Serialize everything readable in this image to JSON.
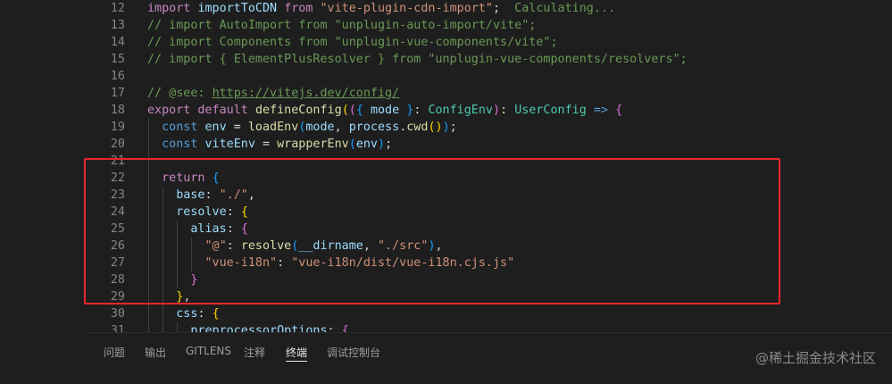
{
  "editor": {
    "lines": [
      {
        "num": "12",
        "tokens": [
          {
            "t": "import ",
            "c": "kw"
          },
          {
            "t": "importToCDN ",
            "c": "var"
          },
          {
            "t": "from ",
            "c": "kw"
          },
          {
            "t": "\"vite-plugin-cdn-import\"",
            "c": "str"
          },
          {
            "t": ";  ",
            "c": "p"
          },
          {
            "t": "Calculating...",
            "c": "inlay"
          }
        ]
      },
      {
        "num": "13",
        "tokens": [
          {
            "t": "// import AutoImport from \"unplugin-auto-import/vite\";",
            "c": "com"
          }
        ]
      },
      {
        "num": "14",
        "tokens": [
          {
            "t": "// import Components from \"unplugin-vue-components/vite\";",
            "c": "com"
          }
        ]
      },
      {
        "num": "15",
        "tokens": [
          {
            "t": "// import { ElementPlusResolver } from \"unplugin-vue-components/resolvers\";",
            "c": "com"
          }
        ]
      },
      {
        "num": "16",
        "tokens": []
      },
      {
        "num": "17",
        "tokens": [
          {
            "t": "// @see: ",
            "c": "com"
          },
          {
            "t": "https://vitejs.dev/config/",
            "c": "link"
          }
        ]
      },
      {
        "num": "18",
        "tokens": [
          {
            "t": "export default ",
            "c": "kw"
          },
          {
            "t": "defineConfig",
            "c": "fn"
          },
          {
            "t": "(",
            "c": "b1"
          },
          {
            "t": "(",
            "c": "b2"
          },
          {
            "t": "{ ",
            "c": "b3"
          },
          {
            "t": "mode ",
            "c": "var"
          },
          {
            "t": "}",
            "c": "b3"
          },
          {
            "t": ": ",
            "c": "p"
          },
          {
            "t": "ConfigEnv",
            "c": "type"
          },
          {
            "t": ")",
            "c": "b2"
          },
          {
            "t": ": ",
            "c": "p"
          },
          {
            "t": "UserConfig ",
            "c": "type"
          },
          {
            "t": "=> ",
            "c": "decl"
          },
          {
            "t": "{",
            "c": "b2"
          }
        ]
      },
      {
        "num": "19",
        "tokens": [
          {
            "t": "  const ",
            "c": "decl"
          },
          {
            "t": "env ",
            "c": "var"
          },
          {
            "t": "= ",
            "c": "p"
          },
          {
            "t": "loadEnv",
            "c": "fn"
          },
          {
            "t": "(",
            "c": "b3"
          },
          {
            "t": "mode",
            "c": "var"
          },
          {
            "t": ", ",
            "c": "p"
          },
          {
            "t": "process",
            "c": "var"
          },
          {
            "t": ".",
            "c": "p"
          },
          {
            "t": "cwd",
            "c": "fn"
          },
          {
            "t": "()",
            "c": "b1"
          },
          {
            "t": ")",
            "c": "b3"
          },
          {
            "t": ";",
            "c": "p"
          }
        ]
      },
      {
        "num": "20",
        "tokens": [
          {
            "t": "  const ",
            "c": "decl"
          },
          {
            "t": "viteEnv ",
            "c": "var"
          },
          {
            "t": "= ",
            "c": "p"
          },
          {
            "t": "wrapperEnv",
            "c": "fn"
          },
          {
            "t": "(",
            "c": "b3"
          },
          {
            "t": "env",
            "c": "var"
          },
          {
            "t": ")",
            "c": "b3"
          },
          {
            "t": ";",
            "c": "p"
          }
        ]
      },
      {
        "num": "21",
        "tokens": []
      },
      {
        "num": "22",
        "tokens": [
          {
            "t": "  return ",
            "c": "kw"
          },
          {
            "t": "{",
            "c": "b3"
          }
        ]
      },
      {
        "num": "23",
        "tokens": [
          {
            "t": "    base",
            "c": "var"
          },
          {
            "t": ": ",
            "c": "p"
          },
          {
            "t": "\"./\"",
            "c": "str"
          },
          {
            "t": ",",
            "c": "p"
          }
        ]
      },
      {
        "num": "24",
        "tokens": [
          {
            "t": "    resolve",
            "c": "var"
          },
          {
            "t": ": ",
            "c": "p"
          },
          {
            "t": "{",
            "c": "b1"
          }
        ]
      },
      {
        "num": "25",
        "tokens": [
          {
            "t": "      alias",
            "c": "var"
          },
          {
            "t": ": ",
            "c": "p"
          },
          {
            "t": "{",
            "c": "b2"
          }
        ]
      },
      {
        "num": "26",
        "tokens": [
          {
            "t": "        \"@\"",
            "c": "str"
          },
          {
            "t": ": ",
            "c": "p"
          },
          {
            "t": "resolve",
            "c": "fn"
          },
          {
            "t": "(",
            "c": "b3"
          },
          {
            "t": "__dirname",
            "c": "var"
          },
          {
            "t": ", ",
            "c": "p"
          },
          {
            "t": "\"./src\"",
            "c": "str"
          },
          {
            "t": ")",
            "c": "b3"
          },
          {
            "t": ",",
            "c": "p"
          }
        ]
      },
      {
        "num": "27",
        "tokens": [
          {
            "t": "        \"vue-i18n\"",
            "c": "str"
          },
          {
            "t": ": ",
            "c": "p"
          },
          {
            "t": "\"vue-i18n/dist/vue-i18n.cjs.js\"",
            "c": "str"
          }
        ]
      },
      {
        "num": "28",
        "tokens": [
          {
            "t": "      }",
            "c": "b2"
          }
        ]
      },
      {
        "num": "29",
        "tokens": [
          {
            "t": "    }",
            "c": "b1"
          },
          {
            "t": ",",
            "c": "p"
          }
        ]
      },
      {
        "num": "30",
        "tokens": [
          {
            "t": "    css",
            "c": "var"
          },
          {
            "t": ": ",
            "c": "p"
          },
          {
            "t": "{",
            "c": "b1"
          }
        ]
      },
      {
        "num": "31",
        "tokens": [
          {
            "t": "      preprocessorOptions",
            "c": "var"
          },
          {
            "t": ": ",
            "c": "p"
          },
          {
            "t": "{",
            "c": "b2"
          }
        ]
      }
    ]
  },
  "panel": {
    "tabs": [
      {
        "label": "问题"
      },
      {
        "label": "输出"
      },
      {
        "label": "GITLENS"
      },
      {
        "label": "注释"
      },
      {
        "label": "终端",
        "active": true
      },
      {
        "label": "调试控制台"
      }
    ]
  },
  "watermark": "@稀土掘金技术社区",
  "colors": {
    "background": "#1e1e1e",
    "highlight_border": "#e8262d",
    "keyword": "#c586c0",
    "string": "#ce9178",
    "comment": "#6a9955",
    "function": "#dcdcaa",
    "type": "#4ec9b0"
  }
}
